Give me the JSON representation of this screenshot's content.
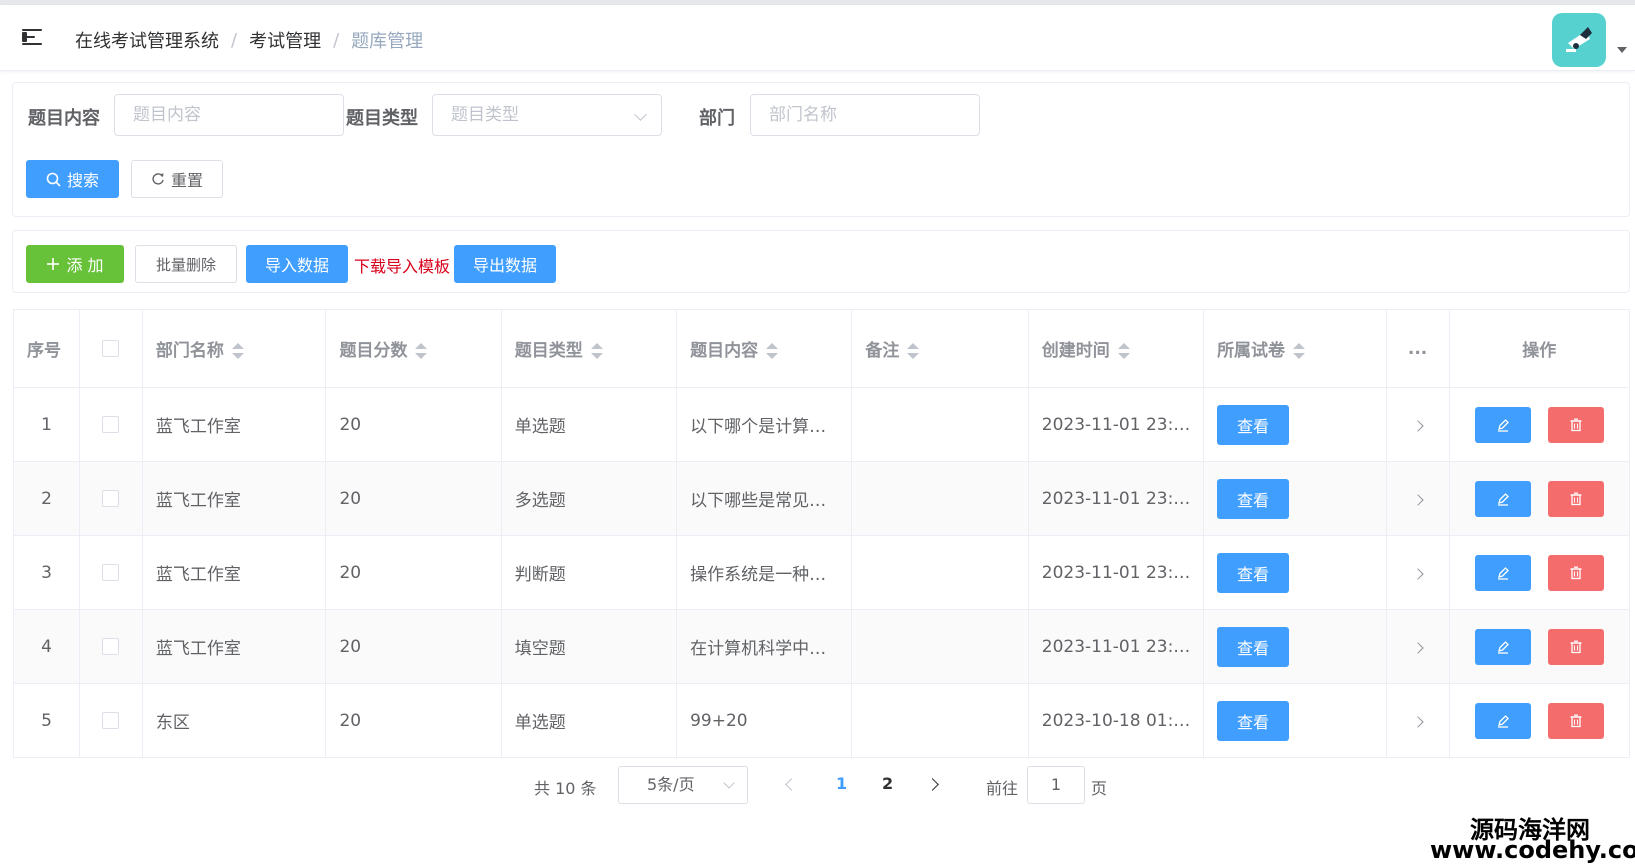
{
  "header": {
    "breadcrumb": [
      "在线考试管理系统",
      "考试管理",
      "题库管理"
    ]
  },
  "search": {
    "content_label": "题目内容",
    "content_placeholder": "题目内容",
    "type_label": "题目类型",
    "type_placeholder": "题目类型",
    "dept_label": "部门",
    "dept_placeholder": "部门名称",
    "search_btn": "搜索",
    "reset_btn": "重置"
  },
  "toolbar": {
    "add": "添 加",
    "batch_delete": "批量删除",
    "import": "导入数据",
    "download_template": "下载导入模板",
    "export": "导出数据"
  },
  "table": {
    "headers": {
      "index": "序号",
      "dept": "部门名称",
      "score": "题目分数",
      "type": "题目类型",
      "content": "题目内容",
      "remark": "备注",
      "created": "创建时间",
      "paper": "所属试卷",
      "more": "...",
      "ops": "操作"
    },
    "view_label": "查看",
    "rows": [
      {
        "index": "1",
        "dept": "蓝飞工作室",
        "score": "20",
        "type": "单选题",
        "content": "以下哪个是计算…",
        "remark": "",
        "created": "2023-11-01 23:…"
      },
      {
        "index": "2",
        "dept": "蓝飞工作室",
        "score": "20",
        "type": "多选题",
        "content": "以下哪些是常见…",
        "remark": "",
        "created": "2023-11-01 23:…"
      },
      {
        "index": "3",
        "dept": "蓝飞工作室",
        "score": "20",
        "type": "判断题",
        "content": "操作系统是一种…",
        "remark": "",
        "created": "2023-11-01 23:…"
      },
      {
        "index": "4",
        "dept": "蓝飞工作室",
        "score": "20",
        "type": "填空题",
        "content": "在计算机科学中…",
        "remark": "",
        "created": "2023-11-01 23:…"
      },
      {
        "index": "5",
        "dept": "东区",
        "score": "20",
        "type": "单选题",
        "content": "99+20",
        "remark": "",
        "created": "2023-10-18 01:…"
      }
    ]
  },
  "pagination": {
    "total": "共 10 条",
    "page_size": "5条/页",
    "pages": [
      "1",
      "2"
    ],
    "current": "1",
    "goto_label": "前往",
    "goto_value": "1",
    "goto_suffix": "页"
  },
  "watermark": {
    "line1": "源码海洋网",
    "line2": "www.codehy.com"
  },
  "colors": {
    "primary": "#409eff",
    "success": "#67c23a",
    "danger": "#f56c6c",
    "link_red": "#d9001b"
  }
}
